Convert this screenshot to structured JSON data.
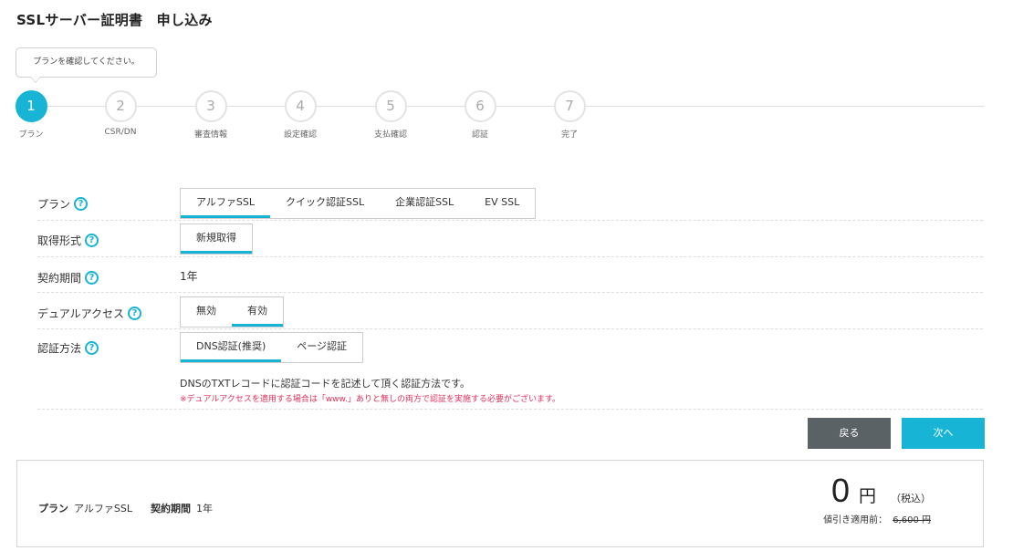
{
  "page_title": "SSLサーバー証明書　申し込み",
  "tooltip_text": "プランを確認してください。",
  "steps": [
    {
      "number": "1",
      "label": "プラン"
    },
    {
      "number": "2",
      "label": "CSR/DN"
    },
    {
      "number": "3",
      "label": "審査情報"
    },
    {
      "number": "4",
      "label": "設定確認"
    },
    {
      "number": "5",
      "label": "支払確認"
    },
    {
      "number": "6",
      "label": "認証"
    },
    {
      "number": "7",
      "label": "完了"
    }
  ],
  "active_step": 1,
  "help_glyph": "?",
  "form": {
    "plan": {
      "label": "プラン",
      "options": [
        "アルファSSL",
        "クイック認証SSL",
        "企業認証SSL",
        "EV SSL"
      ],
      "selected": "アルファSSL"
    },
    "acquisition": {
      "label": "取得形式",
      "options": [
        "新規取得"
      ],
      "selected": "新規取得"
    },
    "term": {
      "label": "契約期間",
      "value": "1年"
    },
    "dual_access": {
      "label": "デュアルアクセス",
      "options": [
        "無効",
        "有効"
      ],
      "selected": "有効"
    },
    "auth_method": {
      "label": "認証方法",
      "options": [
        "DNS認証(推奨)",
        "ページ認証"
      ],
      "selected": "DNS認証(推奨)",
      "description": "DNSのTXTレコードに認証コードを記述して頂く認証方法です。",
      "note": "※デュアルアクセスを適用する場合は「www.」ありと無しの両方で認証を実施する必要がございます。"
    }
  },
  "buttons": {
    "back": "戻る",
    "next": "次へ"
  },
  "summary": {
    "plan_key": "プラン",
    "plan_value": "アルファSSL",
    "term_key": "契約期間",
    "term_value": "1年",
    "price": "0",
    "currency": "円",
    "tax_note": "（税込）",
    "original_label": "値引き適用前：",
    "original_price": "6,600 円"
  },
  "colors": {
    "accent": "#17b4d6",
    "back_button": "#5b6266",
    "note": "#e0305b"
  }
}
